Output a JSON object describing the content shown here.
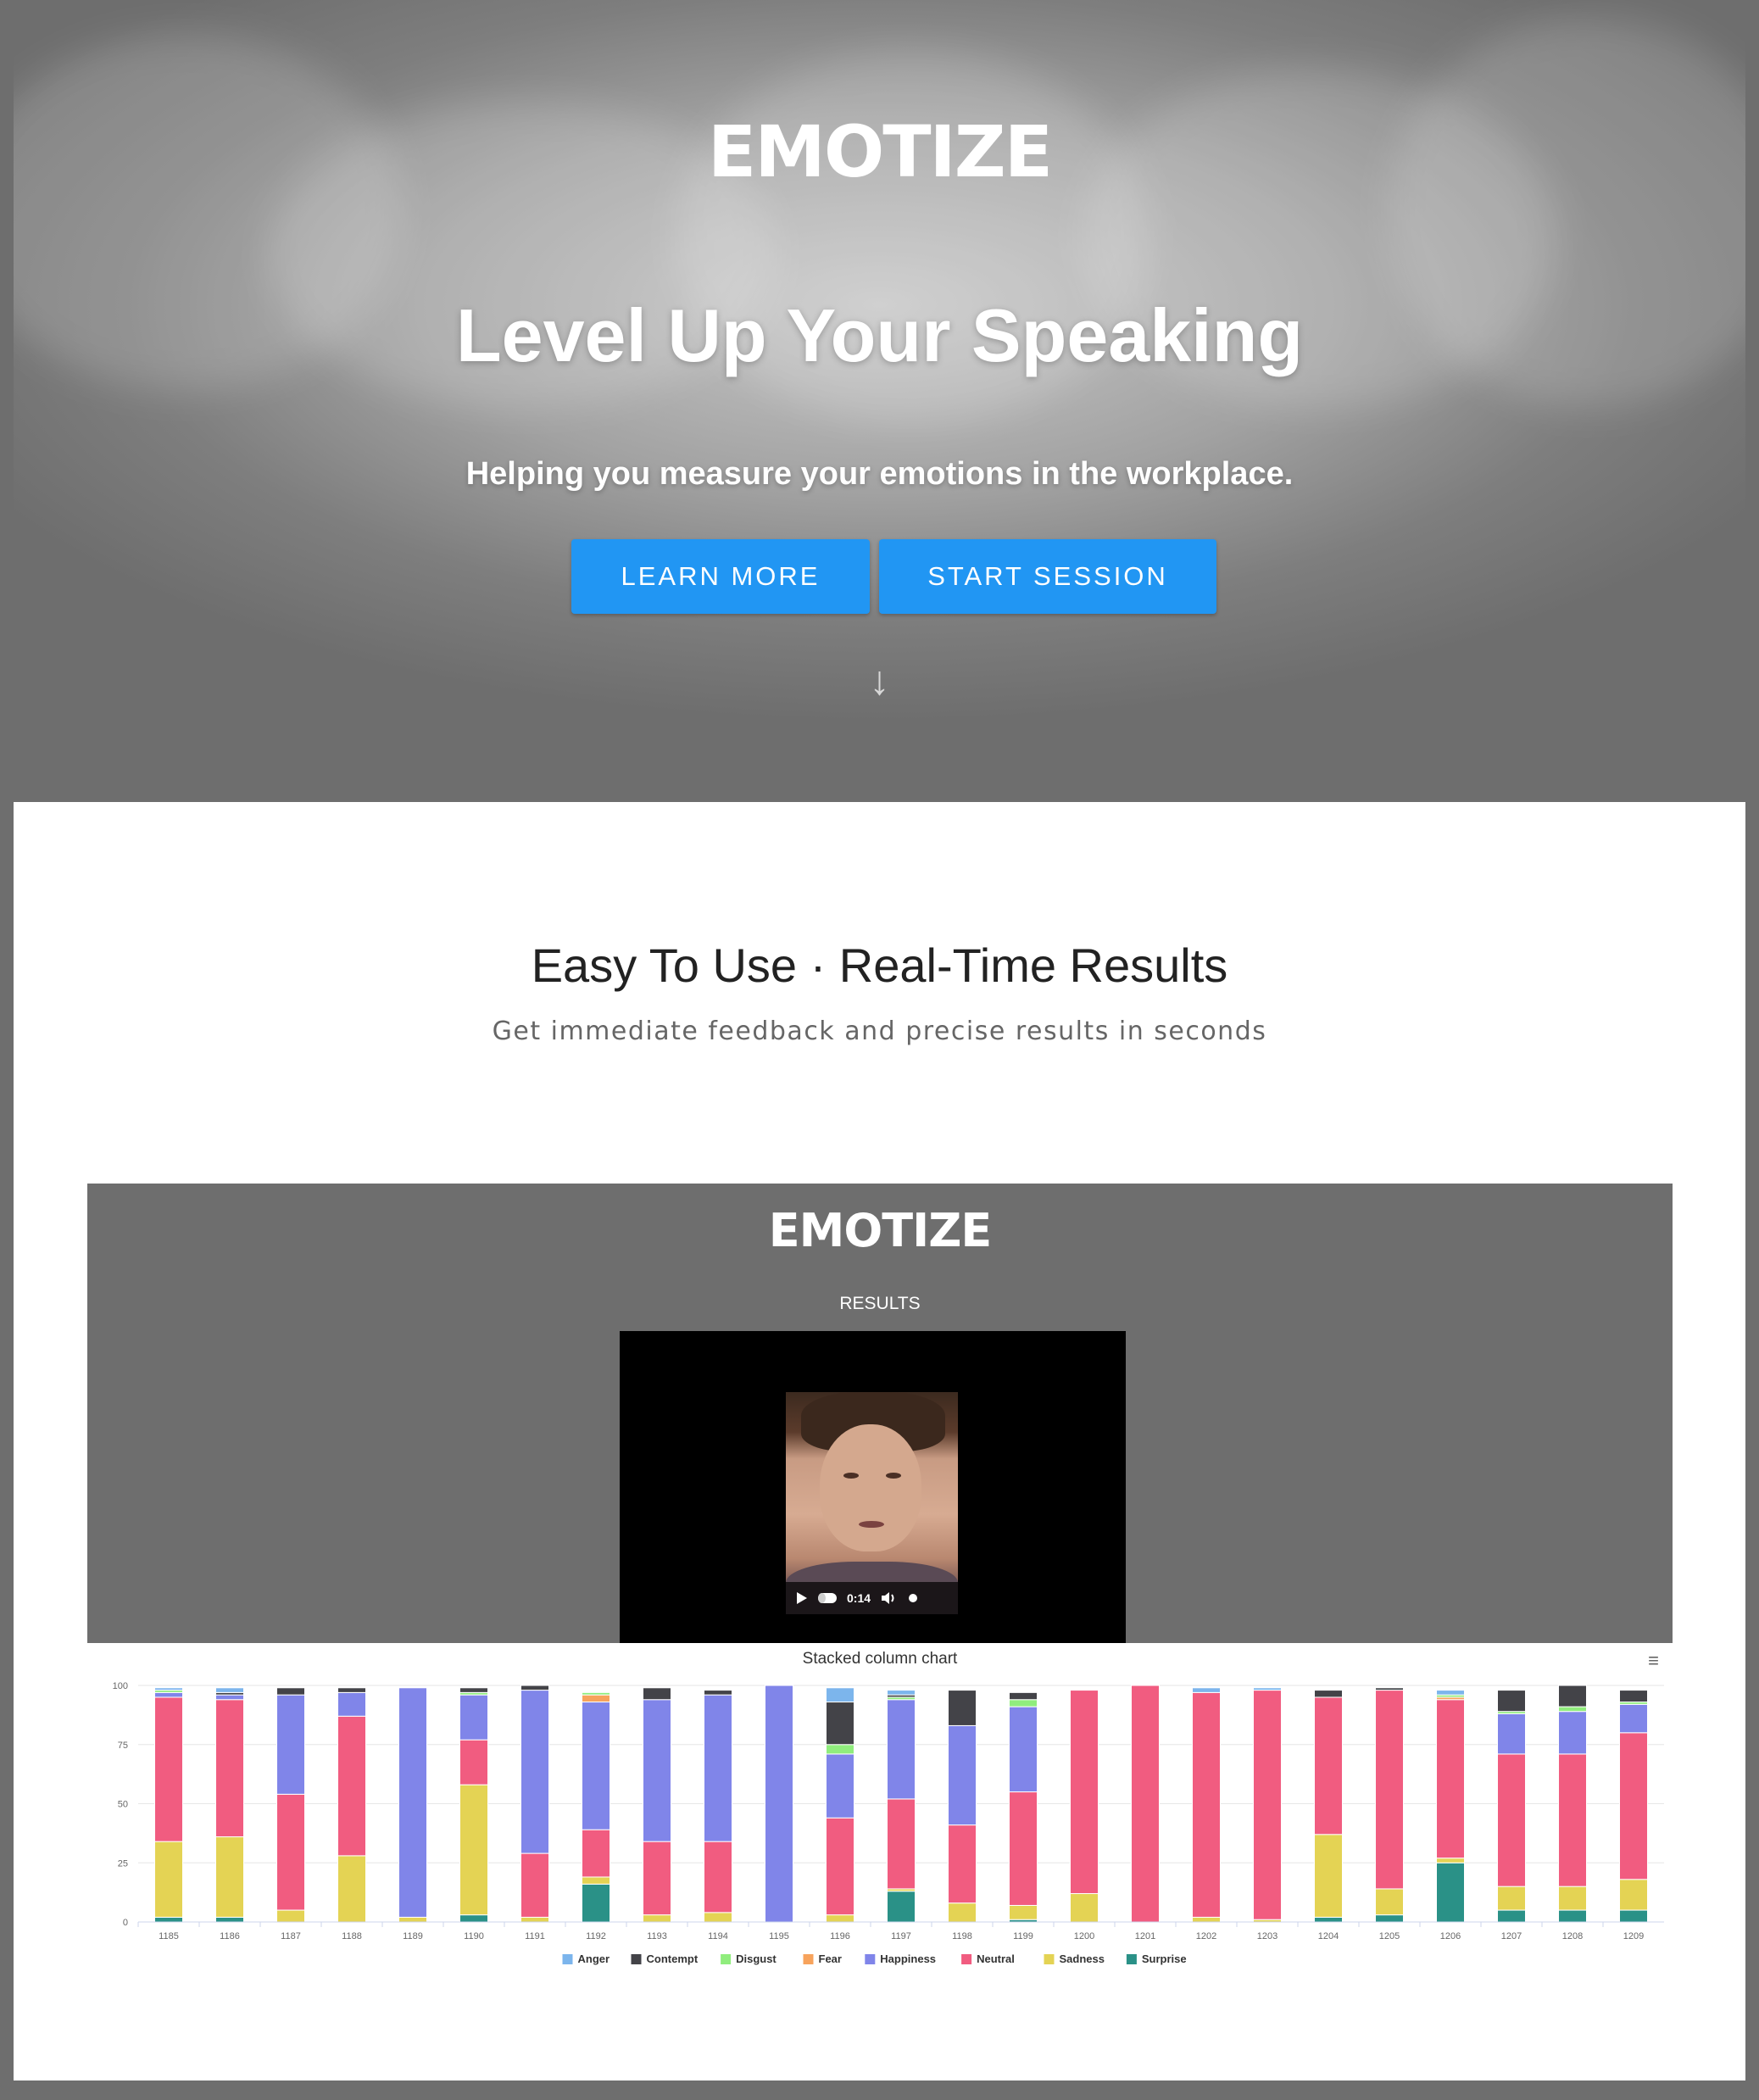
{
  "hero": {
    "brand": "EMOTIZE",
    "headline": "Level Up Your Speaking",
    "subline": "Helping you measure your emotions in the workplace.",
    "learn_more": "LEARN MORE",
    "start_session": "START SESSION",
    "down_arrow": "↓"
  },
  "features": {
    "title": "Easy To Use · Real-Time Results",
    "subtitle": "Get immediate feedback and precise results in seconds"
  },
  "results": {
    "brand": "EMOTIZE",
    "label": "RESULTS",
    "video_time": "0:14"
  },
  "chart_menu_icon": "menu-icon",
  "chart_data": {
    "type": "bar",
    "stacked": true,
    "title": "Stacked column chart",
    "ylabel": "",
    "ylim": [
      0,
      100
    ],
    "yticks": [
      0,
      25,
      50,
      75,
      100
    ],
    "categories": [
      "1185",
      "1186",
      "1187",
      "1188",
      "1189",
      "1190",
      "1191",
      "1192",
      "1193",
      "1194",
      "1195",
      "1196",
      "1197",
      "1198",
      "1199",
      "1200",
      "1201",
      "1202",
      "1203",
      "1204",
      "1205",
      "1206",
      "1207",
      "1208",
      "1209"
    ],
    "series": [
      {
        "name": "Surprise",
        "color": "#2a9187",
        "values": [
          2,
          2,
          0,
          0,
          0,
          3,
          0,
          16,
          0,
          0,
          0,
          0,
          13,
          0,
          1,
          0,
          0,
          0,
          0,
          2,
          3,
          25,
          5,
          5,
          5
        ]
      },
      {
        "name": "Sadness",
        "color": "#e4d354",
        "values": [
          32,
          34,
          5,
          28,
          2,
          55,
          2,
          3,
          3,
          4,
          0,
          3,
          1,
          8,
          6,
          12,
          0,
          2,
          1,
          35,
          11,
          2,
          10,
          10,
          13
        ]
      },
      {
        "name": "Neutral",
        "color": "#f15c80",
        "values": [
          61,
          58,
          49,
          59,
          0,
          19,
          27,
          20,
          31,
          30,
          0,
          41,
          38,
          33,
          48,
          86,
          100,
          95,
          97,
          58,
          84,
          67,
          56,
          56,
          62
        ]
      },
      {
        "name": "Happiness",
        "color": "#8085e9",
        "values": [
          2,
          2,
          42,
          10,
          97,
          19,
          69,
          54,
          60,
          62,
          100,
          27,
          42,
          42,
          36,
          0,
          0,
          0,
          0,
          0,
          0,
          0,
          17,
          18,
          12
        ]
      },
      {
        "name": "Fear",
        "color": "#f7a35c",
        "values": [
          0,
          0,
          0,
          0,
          0,
          0,
          0,
          3,
          0,
          0,
          0,
          0,
          0,
          0,
          0,
          0,
          0,
          0,
          0,
          0,
          0,
          1,
          0,
          0,
          0
        ]
      },
      {
        "name": "Disgust",
        "color": "#90ed7d",
        "values": [
          1,
          0,
          0,
          0,
          0,
          1,
          0,
          1,
          0,
          0,
          0,
          4,
          1,
          0,
          3,
          0,
          0,
          0,
          0,
          0,
          0,
          1,
          1,
          2,
          1
        ]
      },
      {
        "name": "Contempt",
        "color": "#434348",
        "values": [
          0,
          1,
          3,
          2,
          0,
          2,
          2,
          0,
          5,
          2,
          0,
          18,
          1,
          15,
          3,
          0,
          0,
          0,
          0,
          3,
          1,
          0,
          9,
          9,
          5
        ]
      },
      {
        "name": "Anger",
        "color": "#7cb5ec",
        "values": [
          1,
          2,
          0,
          0,
          0,
          0,
          0,
          0,
          0,
          0,
          0,
          6,
          2,
          0,
          0,
          0,
          0,
          2,
          1,
          0,
          0,
          2,
          0,
          0,
          0
        ]
      }
    ],
    "legend_order": [
      "Anger",
      "Contempt",
      "Disgust",
      "Fear",
      "Happiness",
      "Neutral",
      "Sadness",
      "Surprise"
    ],
    "legend_position": "bottom-center",
    "grid": true
  }
}
